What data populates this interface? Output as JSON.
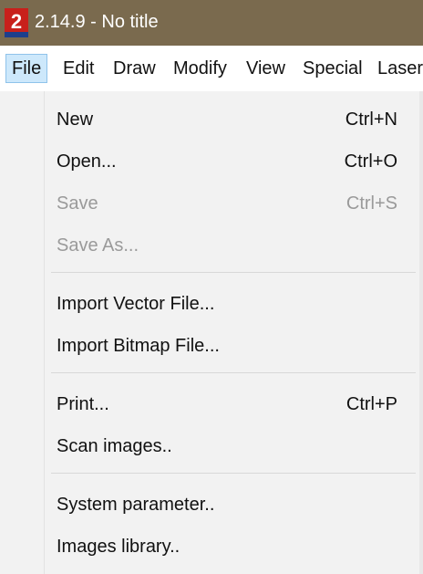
{
  "window": {
    "title": "2.14.9 - No title",
    "titlebar_color": "#7a6a4e",
    "icon": "app-logo-icon",
    "icon_digit": "2"
  },
  "menubar": {
    "items": [
      {
        "label": "File",
        "active": true
      },
      {
        "label": "Edit"
      },
      {
        "label": "Draw"
      },
      {
        "label": "Modify"
      },
      {
        "label": "View"
      },
      {
        "label": "Special"
      },
      {
        "label": "Laser"
      }
    ]
  },
  "file_menu": {
    "items": [
      {
        "label": "New",
        "shortcut": "Ctrl+N",
        "enabled": true
      },
      {
        "label": "Open...",
        "shortcut": "Ctrl+O",
        "enabled": true
      },
      {
        "label": "Save",
        "shortcut": "Ctrl+S",
        "enabled": false
      },
      {
        "label": "Save As...",
        "shortcut": "",
        "enabled": false
      },
      {
        "label": "Import Vector File...",
        "shortcut": "",
        "enabled": true
      },
      {
        "label": "Import Bitmap File...",
        "shortcut": "",
        "enabled": true
      },
      {
        "label": "Print...",
        "shortcut": "Ctrl+P",
        "enabled": true
      },
      {
        "label": "Scan images..",
        "shortcut": "",
        "enabled": true
      },
      {
        "label": "System parameter..",
        "shortcut": "",
        "enabled": true
      },
      {
        "label": "Images library..",
        "shortcut": "",
        "enabled": true
      }
    ]
  },
  "colors": {
    "active_menu_bg": "#cde8fb",
    "disabled_text": "#9a9a9a"
  }
}
